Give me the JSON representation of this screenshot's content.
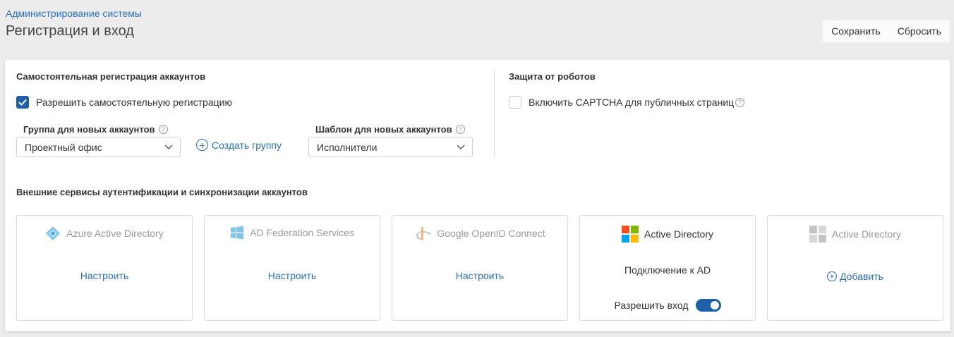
{
  "header": {
    "breadcrumb": "Администрирование системы",
    "title": "Регистрация и вход",
    "save_label": "Сохранить",
    "reset_label": "Сбросить"
  },
  "self_registration": {
    "title": "Самостоятельная регистрация аккаунтов",
    "allow_label": "Разрешить самостоятельную регистрацию",
    "allow_checked": true,
    "group_label": "Группа для новых аккаунтов",
    "group_value": "Проектный офис",
    "create_group_label": "Создать группу",
    "template_label": "Шаблон для новых аккаунтов",
    "template_value": "Исполнители"
  },
  "robots": {
    "title": "Защита от роботов",
    "captcha_label": "Включить CAPTCHA для публичных страниц",
    "captcha_checked": false
  },
  "external": {
    "title": "Внешние сервисы аутентификации и синхронизации аккаунтов",
    "cards": [
      {
        "name": "Azure Active Directory",
        "icon": "azure-ad-icon",
        "action": "Настроить"
      },
      {
        "name": "AD Federation Services",
        "icon": "windows-icon",
        "action": "Настроить"
      },
      {
        "name": "Google OpenID Connect",
        "icon": "openid-icon",
        "action": "Настроить"
      },
      {
        "name": "Active Directory",
        "icon": "microsoft-icon",
        "status": "Подключение к AD",
        "toggle_label": "Разрешить вход",
        "toggle_on": true
      },
      {
        "name": "Active Directory",
        "icon": "microsoft-gray-icon",
        "action": "Добавить"
      }
    ]
  },
  "colors": {
    "accent": "#1f5fa8",
    "link": "#2a6fb8",
    "muted": "#9a9a9a"
  }
}
